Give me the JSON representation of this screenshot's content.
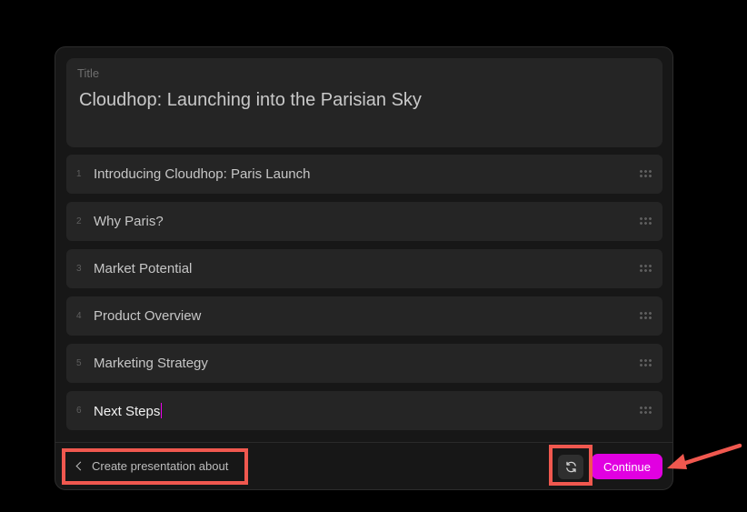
{
  "title_section": {
    "label": "Title",
    "value": "Cloudhop: Launching into the Parisian Sky"
  },
  "outline": [
    {
      "num": "1",
      "label": "Introducing Cloudhop: Paris Launch"
    },
    {
      "num": "2",
      "label": "Why Paris?"
    },
    {
      "num": "3",
      "label": "Market Potential"
    },
    {
      "num": "4",
      "label": "Product Overview"
    },
    {
      "num": "5",
      "label": "Marketing Strategy"
    },
    {
      "num": "6",
      "label": "Next Steps"
    }
  ],
  "footer": {
    "back_label": "Create presentation about",
    "continue_label": "Continue"
  },
  "colors": {
    "accent": "#e100e1",
    "highlight": "#f0584f"
  },
  "icons": {
    "back": "chevron-left-icon",
    "refresh": "refresh-icon",
    "drag": "drag-handle-icon"
  }
}
